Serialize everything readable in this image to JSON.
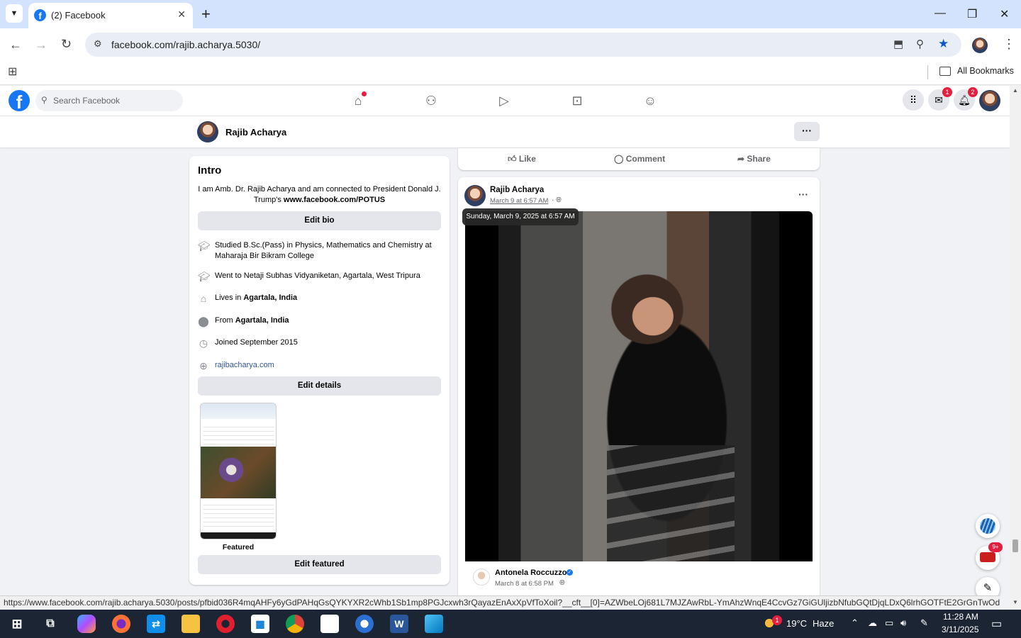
{
  "browser": {
    "tab_title": "(2) Facebook",
    "tab_close": "✕",
    "new_tab": "+",
    "url": "facebook.com/rajib.acharya.5030/",
    "all_bookmarks": "All Bookmarks",
    "window_controls": {
      "minimize": "—",
      "maximize": "❐",
      "close": "✕"
    }
  },
  "facebook": {
    "search_placeholder": "Search Facebook",
    "messenger_badge": "1",
    "notifications_badge": "2",
    "profile_name": "Rajib Acharya",
    "more_label": "···"
  },
  "intro": {
    "heading": "Intro",
    "bio_text": "I am Amb. Dr. Rajib Acharya and am connected to President Donald J. Trump's ",
    "bio_link": "www.facebook.com/POTUS",
    "edit_bio": "Edit bio",
    "studied": "Studied B.Sc.(Pass) in Physics, Mathematics and Chemistry at Maharaja Bir Bikram College",
    "went_to": "Went to Netaji Subhas Vidyaniketan, Agartala, West Tripura",
    "lives_prefix": "Lives in ",
    "lives_place": "Agartala, India",
    "from_prefix": "From ",
    "from_place": "Agartala, India",
    "joined": "Joined September 2015",
    "website": "rajibacharya.com",
    "edit_details": "Edit details",
    "featured_label": "Featured",
    "edit_featured": "Edit featured"
  },
  "post_actions": {
    "like": "Like",
    "comment": "Comment",
    "share": "Share"
  },
  "post": {
    "author": "Rajib Acharya",
    "timestamp": "March 9 at 6:57 AM",
    "separator": "·",
    "tooltip": "Sunday, March 9, 2025 at 6:57 AM",
    "more": "···",
    "shared_author": "Antonela Roccuzzo",
    "shared_timestamp": "March 8 at 6:58 PM"
  },
  "status_url": "https://www.facebook.com/rajib.acharya.5030/posts/pfbid036R4mqAHFy6yGdPAHqGsQYKYXR2cWhb1Sb1mp8PGJcxwh3rQayazEnAxXpVfToXoil?__cft__[0]=AZWbeLOj681L7MJZAwRbL-YmAhzWnqE4CcvGz7GiGUljizbNfubGQtDjqLDxQ6lrhGOTFtE2GrGnTwOdeRY_Fb...",
  "floating": {
    "news_badge": "9+"
  },
  "taskbar": {
    "weather_temp": "19°C",
    "weather_desc": "Haze",
    "weather_badge": "1",
    "time": "11:28 AM",
    "date": "3/11/2025"
  }
}
